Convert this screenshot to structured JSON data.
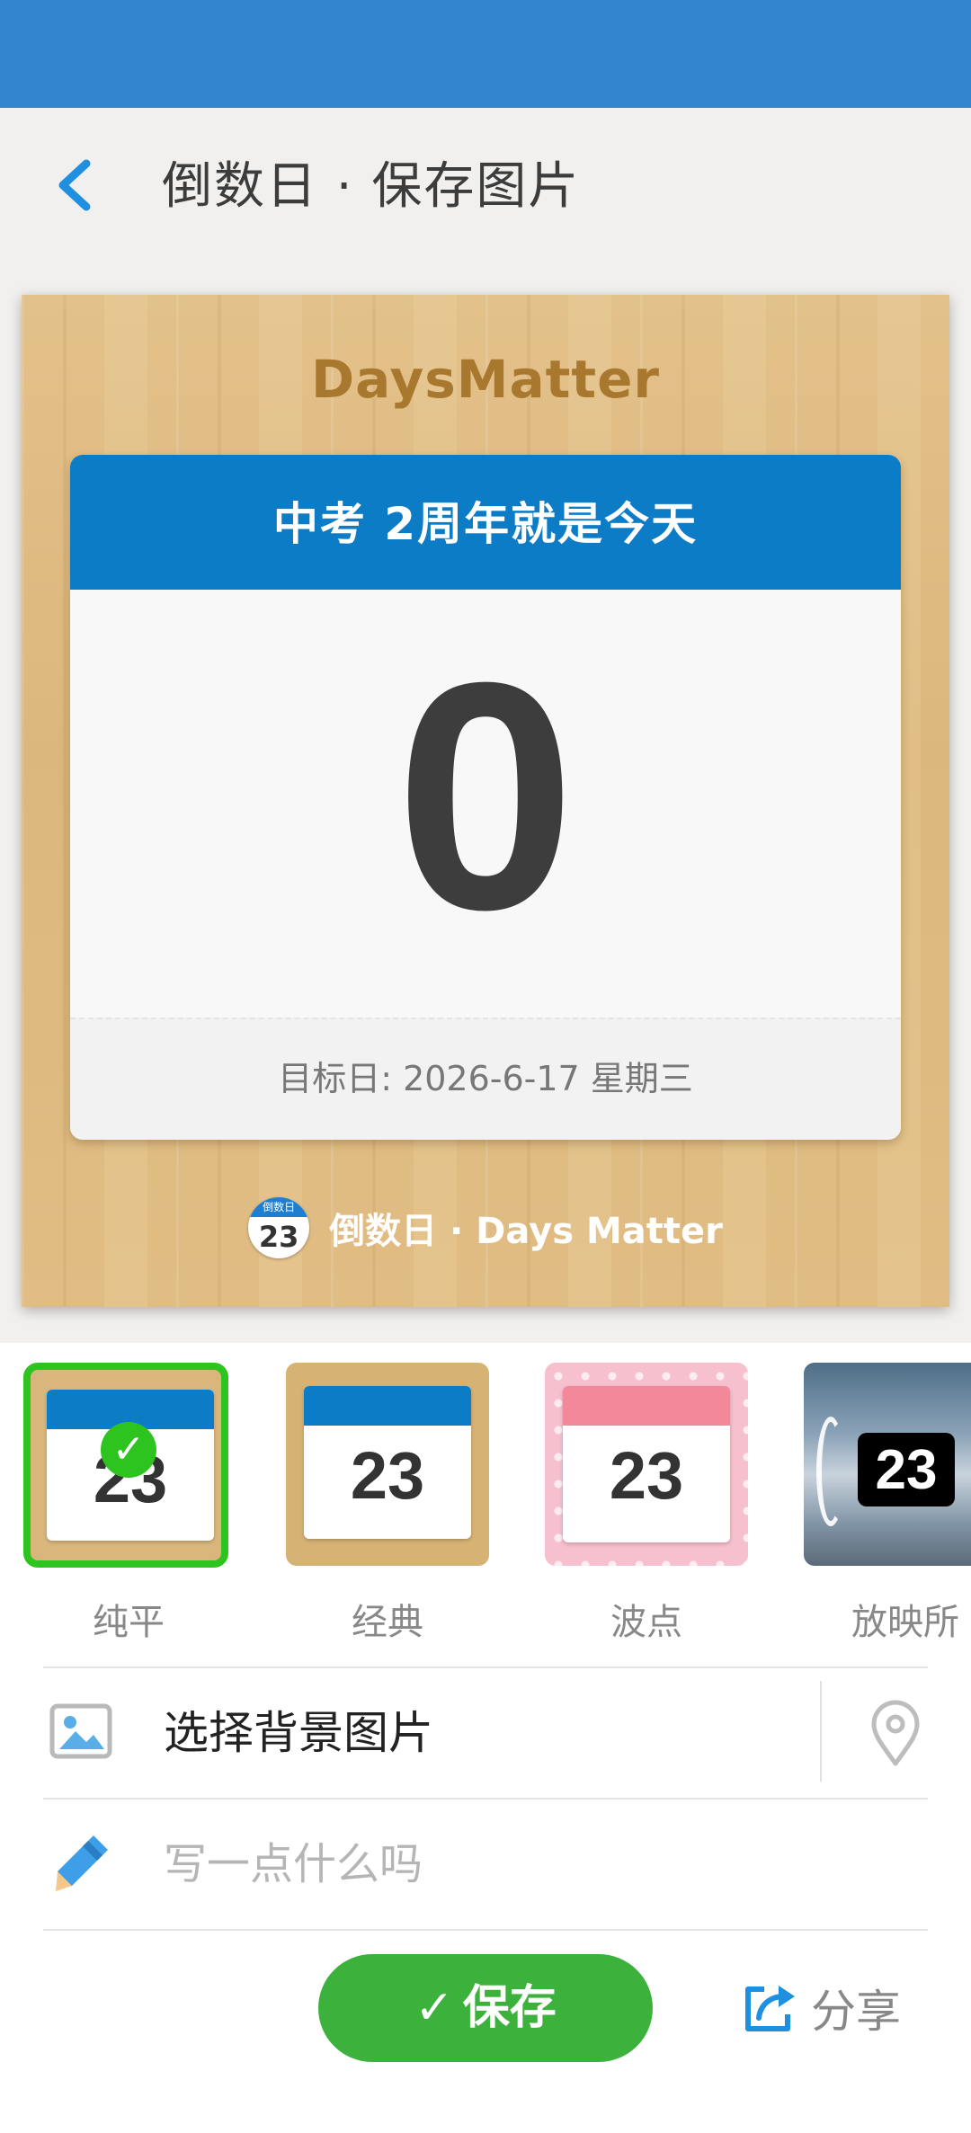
{
  "header": {
    "title": "倒数日 · 保存图片"
  },
  "preview": {
    "brand": "DaysMatter",
    "event_title": "中考 2周年就是今天",
    "days": "0",
    "target_date": "目标日: 2026-6-17 星期三",
    "app_icon_top": "倒数日",
    "app_icon_num": "23",
    "app_signature": "倒数日 · Days Matter"
  },
  "themes": [
    {
      "label": "纯平",
      "sample": "23",
      "selected": true
    },
    {
      "label": "经典",
      "sample": "23",
      "selected": false
    },
    {
      "label": "波点",
      "sample": "23",
      "selected": false
    },
    {
      "label": "放映所",
      "sample": "23",
      "selected": false
    }
  ],
  "actions": {
    "background_label": "选择背景图片",
    "note_placeholder": "写一点什么吗",
    "save_label": "保存",
    "share_label": "分享"
  },
  "colors": {
    "status_bar": "#3385d0",
    "accent_blue": "#0d7cc6",
    "selected_green": "#2dc41f",
    "save_green": "#3cb23c"
  }
}
